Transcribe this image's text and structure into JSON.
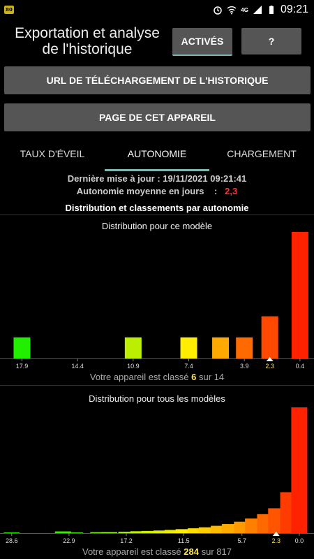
{
  "status_bar": {
    "badge": "80",
    "time": "09:21",
    "network": "4G"
  },
  "header": {
    "title": "Exportation et analyse de l'historique",
    "actives_label": "ACTIVÉS",
    "help_label": "?"
  },
  "buttons": {
    "url_label": "URL DE TÉLÉCHARGEMENT DE L'HISTORIQUE",
    "page_label": "PAGE DE CET APPAREIL"
  },
  "tabs": [
    {
      "label": "TAUX D'ÉVEIL"
    },
    {
      "label": "AUTONOMIE"
    },
    {
      "label": "CHARGEMENT"
    }
  ],
  "info": {
    "last_update": "Dernière mise à jour : 19/11/2021 09:21:41",
    "avg_label": "Autonomie moyenne en jours",
    "avg_sep": ":",
    "avg_value": "2,3",
    "section_title": "Distribution et classements par autonomie"
  },
  "chart_data": [
    {
      "type": "bar",
      "title": "Distribution pour ce modèle",
      "tick_labels": [
        "17.9",
        "14.4",
        "10.9",
        "7.4",
        "3.9",
        "2.3",
        "0.4"
      ],
      "highlight_tick": "2.3",
      "bars": [
        {
          "x": 17.9,
          "value": 1,
          "color": "#22ee00"
        },
        {
          "x": 10.9,
          "value": 1,
          "color": "#bbee00"
        },
        {
          "x": 7.4,
          "value": 1,
          "color": "#ffee00"
        },
        {
          "x": 5.4,
          "value": 1,
          "color": "#ffaa00"
        },
        {
          "x": 3.9,
          "value": 1,
          "color": "#ff6a00"
        },
        {
          "x": 2.3,
          "value": 2,
          "color": "#ff4800"
        },
        {
          "x": 0.4,
          "value": 6,
          "color": "#ff2200"
        }
      ],
      "xlim": [
        18.8,
        0.0
      ],
      "ylim": [
        0,
        6
      ],
      "rank": {
        "prefix": "Votre appareil est classé",
        "position": "6",
        "sep": "sur",
        "total": "14"
      }
    },
    {
      "type": "bar",
      "title": "Distribution pour tous les modèles",
      "tick_labels": [
        "28.6",
        "22.9",
        "17.2",
        "11.5",
        "5.7",
        "2.3",
        "0.0"
      ],
      "highlight_tick": "2.3",
      "bars": [
        {
          "x": 28.6,
          "value": 0.5,
          "color": "#22ee00"
        },
        {
          "x": 23.5,
          "value": 1.2,
          "color": "#33ee00"
        },
        {
          "x": 22.3,
          "value": 0.5,
          "color": "#44ee00"
        },
        {
          "x": 20.0,
          "value": 0.7,
          "color": "#66ee00"
        },
        {
          "x": 18.9,
          "value": 0.8,
          "color": "#77ee00"
        },
        {
          "x": 17.2,
          "value": 1.0,
          "color": "#99ee00"
        },
        {
          "x": 16.0,
          "value": 1.3,
          "color": "#bbee00"
        },
        {
          "x": 14.9,
          "value": 1.5,
          "color": "#ccee00"
        },
        {
          "x": 13.7,
          "value": 1.8,
          "color": "#ddee00"
        },
        {
          "x": 12.6,
          "value": 2.2,
          "color": "#eeee00"
        },
        {
          "x": 11.5,
          "value": 2.7,
          "color": "#ffee00"
        },
        {
          "x": 10.3,
          "value": 3.3,
          "color": "#ffdd00"
        },
        {
          "x": 9.2,
          "value": 4.0,
          "color": "#ffcc00"
        },
        {
          "x": 8.0,
          "value": 5.0,
          "color": "#ffbb00"
        },
        {
          "x": 6.9,
          "value": 6.2,
          "color": "#ffaa00"
        },
        {
          "x": 5.7,
          "value": 7.8,
          "color": "#ff9900"
        },
        {
          "x": 4.6,
          "value": 10,
          "color": "#ff8000"
        },
        {
          "x": 3.4,
          "value": 13,
          "color": "#ff6a00"
        },
        {
          "x": 2.3,
          "value": 17,
          "color": "#ff5500"
        },
        {
          "x": 1.1,
          "value": 28,
          "color": "#ff3c00"
        },
        {
          "x": 0.0,
          "value": 86,
          "color": "#ff2200"
        }
      ],
      "xlim": [
        29.0,
        -0.7
      ],
      "ylim": [
        0,
        86
      ],
      "rank": {
        "prefix": "Votre appareil est classé",
        "position": "284",
        "sep": "sur",
        "total": "817"
      }
    }
  ]
}
